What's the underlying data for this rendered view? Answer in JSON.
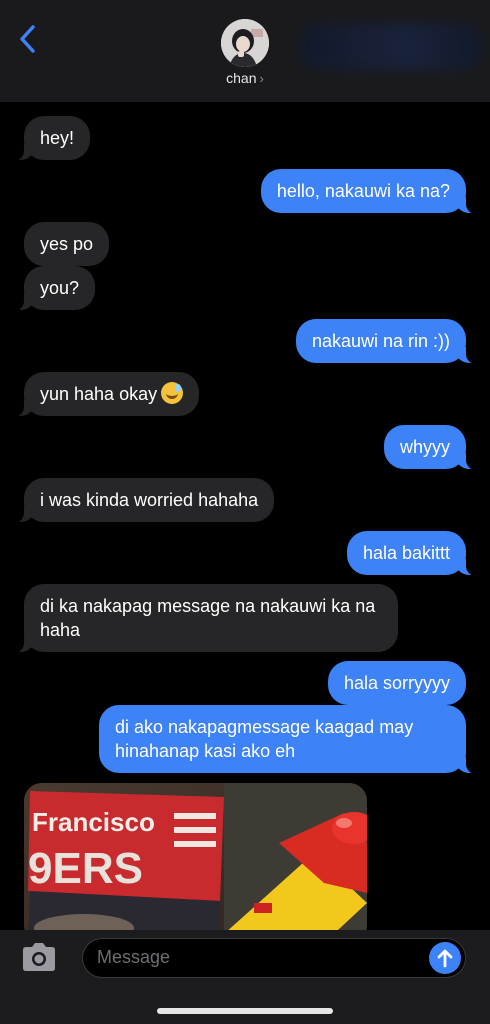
{
  "header": {
    "contact_name": "chan",
    "back_icon": "chevron-left-icon"
  },
  "colors": {
    "accent": "#3d82f6",
    "incoming_bubble": "#262628",
    "background": "#000000",
    "header_bg": "#1a1a1c"
  },
  "messages": [
    {
      "from": "them",
      "text": "hey!"
    },
    {
      "from": "me",
      "text": "hello, nakauwi ka na?"
    },
    {
      "from": "them",
      "text": "yes po"
    },
    {
      "from": "them",
      "text": "you?"
    },
    {
      "from": "me",
      "text": "nakauwi na rin :))"
    },
    {
      "from": "them",
      "text": "yun haha okay",
      "emoji": "grinning-sweat-emoji"
    },
    {
      "from": "me",
      "text": "whyyy"
    },
    {
      "from": "them",
      "text": "i was kinda worried hahaha"
    },
    {
      "from": "me",
      "text": "hala bakittt"
    },
    {
      "from": "them",
      "text": "di ka nakapag message na nakauwi ka na haha"
    },
    {
      "from": "me",
      "text": "hala sorryyyy"
    },
    {
      "from": "me",
      "text": "di ako nakapagmessage kaagad may hinahanap kasi ako eh"
    }
  ],
  "photo": {
    "sign_line1": "Francisco",
    "sign_line2": "9ERS"
  },
  "composer": {
    "placeholder": "Message",
    "camera_icon": "camera-icon",
    "send_icon": "send-arrow-icon"
  }
}
